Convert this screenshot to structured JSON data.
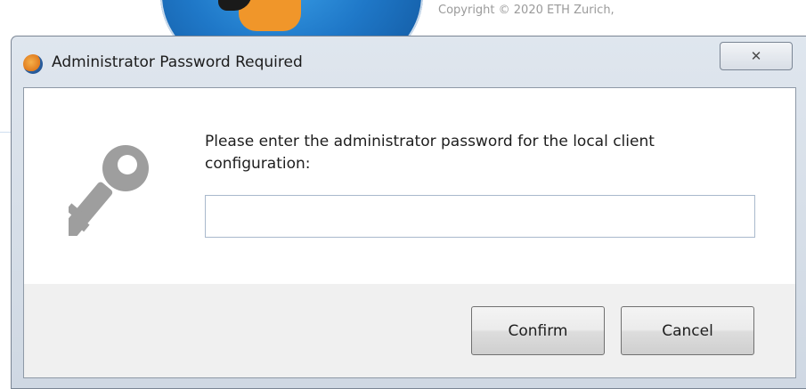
{
  "background_app": {
    "copyright": "Copyright © 2020 ETH Zurich,"
  },
  "dialog": {
    "title": "Administrator Password Required",
    "close_glyph": "✕",
    "message": "Please enter the administrator password for the local client configuration:",
    "password_value": "",
    "icons": {
      "app": "app-logo-icon",
      "key": "key-icon",
      "close": "close-icon"
    },
    "buttons": {
      "confirm": "Confirm",
      "cancel": "Cancel"
    }
  },
  "colors": {
    "titlebar": "#dfe6ee",
    "footer": "#f0f0f0",
    "input_border": "#a9b9cc",
    "key_icon": "#9e9e9e"
  }
}
